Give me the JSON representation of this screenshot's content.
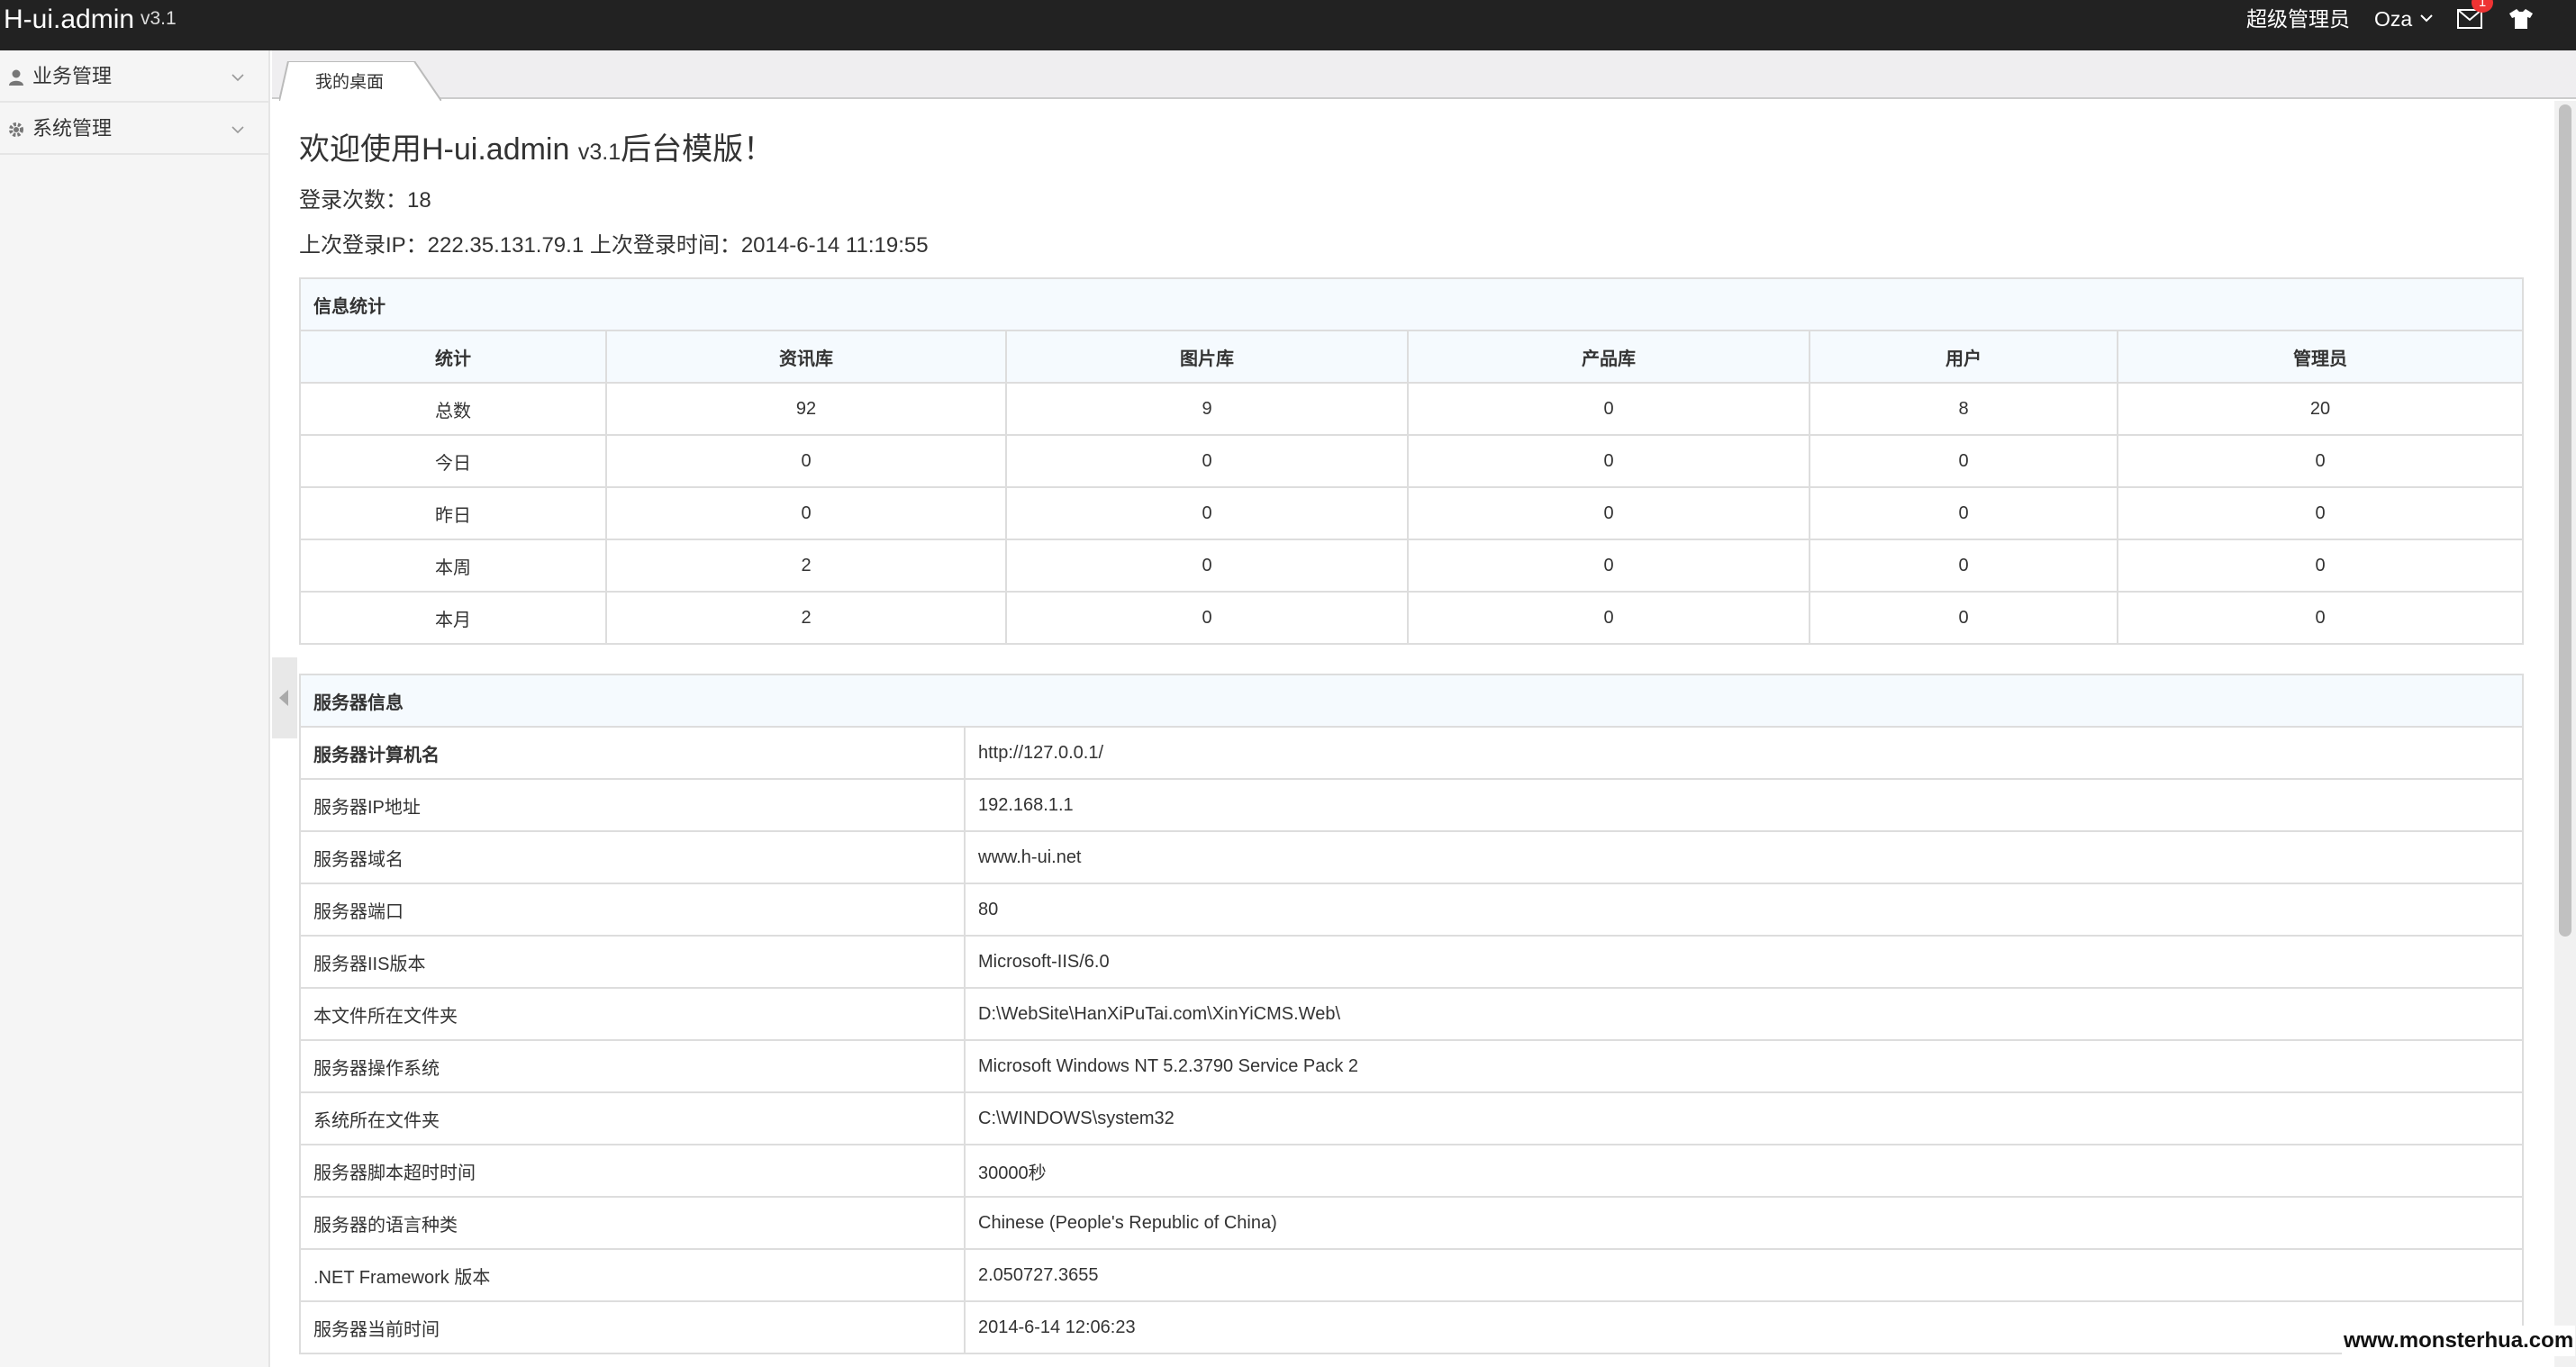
{
  "header": {
    "logo": "H-ui.admin",
    "version": "v3.1",
    "role": "超级管理员",
    "user": "Oza",
    "mail_badge": "1"
  },
  "sidebar": {
    "items": [
      {
        "label": "业务管理",
        "icon": "user-icon"
      },
      {
        "label": "系统管理",
        "icon": "gear-icon"
      }
    ]
  },
  "tabs": [
    {
      "label": "我的桌面"
    }
  ],
  "welcome": {
    "title_prefix": "欢迎使用H-ui.admin ",
    "title_version": "v3.1",
    "title_suffix": "后台模版！",
    "login_count": "登录次数：18",
    "last_login": "上次登录IP：222.35.131.79.1 上次登录时间：2014-6-14 11:19:55"
  },
  "stats": {
    "caption": "信息统计",
    "headers": [
      "统计",
      "资讯库",
      "图片库",
      "产品库",
      "用户",
      "管理员"
    ],
    "rows": [
      [
        "总数",
        "92",
        "9",
        "0",
        "8",
        "20"
      ],
      [
        "今日",
        "0",
        "0",
        "0",
        "0",
        "0"
      ],
      [
        "昨日",
        "0",
        "0",
        "0",
        "0",
        "0"
      ],
      [
        "本周",
        "2",
        "0",
        "0",
        "0",
        "0"
      ],
      [
        "本月",
        "2",
        "0",
        "0",
        "0",
        "0"
      ]
    ]
  },
  "server": {
    "caption": "服务器信息",
    "rows": [
      [
        "服务器计算机名",
        "http://127.0.0.1/"
      ],
      [
        "服务器IP地址",
        "192.168.1.1"
      ],
      [
        "服务器域名",
        "www.h-ui.net"
      ],
      [
        "服务器端口",
        "80"
      ],
      [
        "服务器IIS版本",
        "Microsoft-IIS/6.0"
      ],
      [
        "本文件所在文件夹",
        "D:\\WebSite\\HanXiPuTai.com\\XinYiCMS.Web\\"
      ],
      [
        "服务器操作系统",
        "Microsoft Windows NT 5.2.3790 Service Pack 2"
      ],
      [
        "系统所在文件夹",
        "C:\\WINDOWS\\system32"
      ],
      [
        "服务器脚本超时时间",
        "30000秒"
      ],
      [
        "服务器的语言种类",
        "Chinese (People's Republic of China)"
      ],
      [
        ".NET Framework 版本",
        "2.050727.3655"
      ],
      [
        "服务器当前时间",
        "2014-6-14 12:06:23"
      ]
    ]
  },
  "watermark": "www.monsterhua.com"
}
